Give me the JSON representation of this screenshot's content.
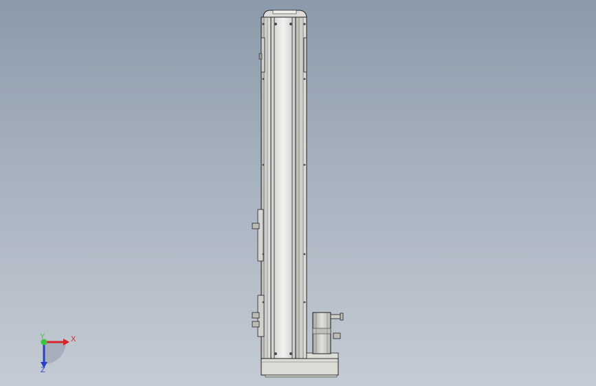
{
  "viewport": {
    "background_top": "#8b9aaa",
    "background_bottom": "#c4cbd4"
  },
  "triad": {
    "x_label": "X",
    "y_label": "Y",
    "z_label": "Z",
    "x_color": "#d8232a",
    "y_color": "#3cc43c",
    "z_color": "#2a3fc8"
  },
  "model": {
    "name": "linear-actuator-column",
    "body_color": "#e6e6e2",
    "edge_color": "#1e1e1e"
  }
}
